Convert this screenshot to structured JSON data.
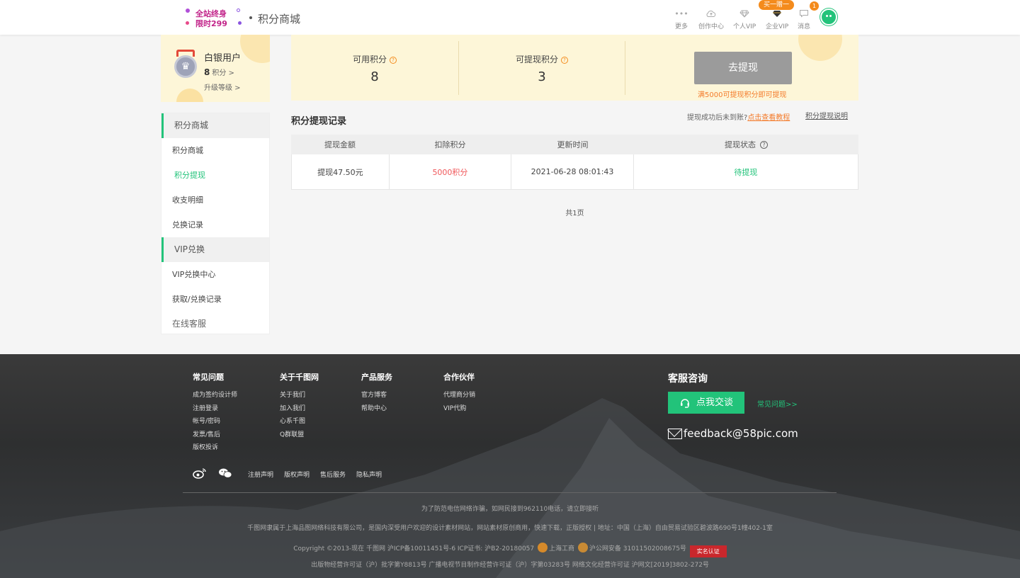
{
  "header": {
    "promo_line1": "全站终身",
    "promo_line2": "限时299",
    "site_title": "积分商城",
    "nav": [
      {
        "label": "更多",
        "icon": "more-icon"
      },
      {
        "label": "创作中心",
        "icon": "upload-cloud-icon"
      },
      {
        "label": "个人VIP",
        "icon": "diamond-icon"
      },
      {
        "label": "企业VIP",
        "icon": "enterprise-vip-icon"
      },
      {
        "label": "消息",
        "icon": "message-icon"
      }
    ],
    "buy_badge": "买一赠一",
    "message_count": "1"
  },
  "user": {
    "name": "白银用户",
    "points": "8",
    "points_label": "积分 >",
    "upgrade": "升级等级 >"
  },
  "sidebar": {
    "group1": "积分商城",
    "items1": [
      "积分商城",
      "积分提现",
      "收支明细",
      "兑换记录"
    ],
    "group2": "VIP兑换",
    "items2": [
      "VIP兑换中心",
      "获取/兑换记录"
    ],
    "service": "在线客服"
  },
  "points_panel": {
    "available_label": "可用积分",
    "available_value": "8",
    "withdrawable_label": "可提现积分",
    "withdrawable_value": "3",
    "withdraw_button": "去提现",
    "withdraw_tip": "满5000可提现积分即可提现"
  },
  "records": {
    "title": "积分提现记录",
    "help_text": "提现成功后未到账?",
    "help_link": "点击查看教程",
    "explain_link": "积分提现说明",
    "columns": [
      "提现金额",
      "扣除积分",
      "更新时间",
      "提现状态"
    ],
    "rows": [
      {
        "amount": "提现47.50元",
        "points": "5000积分",
        "time": "2021-06-28 08:01:43",
        "status": "待提现"
      }
    ],
    "pager": "共1页"
  },
  "footer": {
    "columns": [
      {
        "title": "常见问题",
        "links": [
          "成为签约设计师",
          "注册登录",
          "帐号/密码",
          "发票/售后",
          "版权投诉"
        ]
      },
      {
        "title": "关于千图网",
        "links": [
          "关于我们",
          "加入我们",
          "心系千图",
          "Q群联盟"
        ]
      },
      {
        "title": "产品服务",
        "links": [
          "官方博客",
          "帮助中心"
        ]
      },
      {
        "title": "合作伙伴",
        "links": [
          "代理商分销",
          "VIP代购"
        ]
      }
    ],
    "service_title": "客服咨询",
    "chat_button": "点我交谈",
    "faq_link": "常见问题>>",
    "email": "feedback@58pic.com",
    "bottom_links": [
      "注册声明",
      "版权声明",
      "售后服务",
      "隐私声明"
    ],
    "line1": "为了防范电信网络诈骗，如网民接到962110电话，请立即接听",
    "line2": "千图网隶属于上海品图网络科技有限公司，是国内深受用户欢迎的设计素材网站，网站素材原创商用，快速下载，正版授权 | 地址：中国（上海）自由贸易试验区碧波路690号1幢402-1室",
    "line3a": "Copyright ©2013-现在 千图网 沪ICP备10011451号-6 ICP证书: 沪B2-20180057",
    "line3b": "上海工商",
    "line3c": "沪公网安备 31011502008675号",
    "line3d": "实名认证",
    "line4": "出版物经营许可证（沪）批字第Y8813号   广播电视节目制作经营许可证（沪）字第03283号   网络文化经营许可证 沪网文[2019]3802-272号"
  }
}
